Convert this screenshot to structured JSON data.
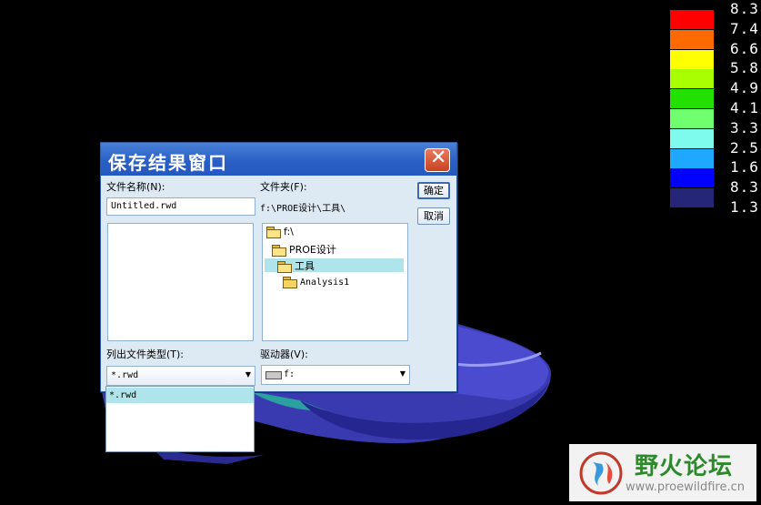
{
  "legend": {
    "labels": [
      "8.3",
      "7.4",
      "6.6",
      "5.8",
      "4.9",
      "4.1",
      "3.3",
      "2.5",
      "1.6",
      "8.3",
      "1.3"
    ],
    "colors": [
      "#ff0000",
      "#ff6a00",
      "#ffff00",
      "#a8ff00",
      "#22e000",
      "#6fff6f",
      "#7ffbee",
      "#1fa8ff",
      "#0000ff",
      "#262678"
    ]
  },
  "dialog": {
    "title": "保存结果窗口",
    "close_icon": "close-icon",
    "filename_label": "文件名称(N):",
    "filename_value": "Untitled.rwd",
    "folder_label": "文件夹(F):",
    "folder_path": "f:\\PROE设计\\工具\\",
    "folder_tree": [
      "f:\\",
      "PROE设计",
      "工具",
      "Analysis1"
    ],
    "selected_folder_index": 2,
    "ok_button": "确定",
    "cancel_button": "取消",
    "filetype_label": "列出文件类型(T):",
    "filetype_value": "*.rwd",
    "filetype_options": [
      "*.rwd"
    ],
    "drive_label": "驱动器(V):",
    "drive_value": "f:"
  },
  "watermark": {
    "title": "野火论坛",
    "url": "www.proewildfire.cn"
  },
  "colors": {
    "titlebar": "#2a5fc5",
    "dialog_bg": "#dde9f3",
    "selection": "#aee4ea",
    "viewport_bg": "#000000"
  }
}
